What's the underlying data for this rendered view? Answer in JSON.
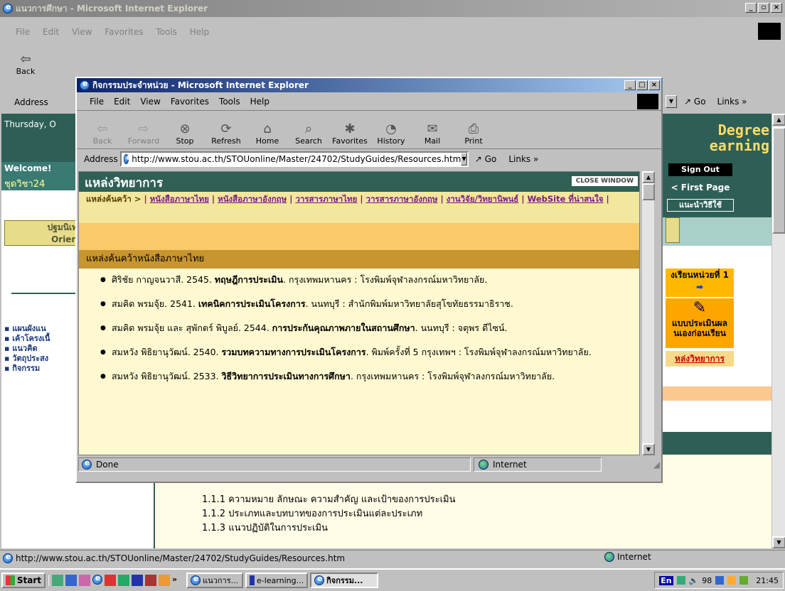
{
  "bg_window": {
    "title": "แนวการศึกษา - Microsoft Internet Explorer",
    "menu": [
      "File",
      "Edit",
      "View",
      "Favorites",
      "Tools",
      "Help"
    ],
    "toolbar": [
      "Back"
    ],
    "address_label": "Address",
    "go_label": "Go",
    "links_label": "Links »",
    "date_text": "Thursday, O",
    "welcome": "Welcome!",
    "course": "ชุดวิชา24",
    "orient_1": "ปฐมนิเท",
    "orient_2": "Orien",
    "left_menu": [
      "แผนผังแน",
      "เค้าโครงเนื้",
      "แนวคิด",
      "วัตถุประสง",
      "กิจกรรม"
    ],
    "degree_1": "Degree",
    "degree_2": "earning",
    "sign_out": "Sign Out",
    "first_page": "< First Page",
    "guide": "แนะนำวิธีใช้",
    "unit_title": "งเรียนหน่วยที่ 1",
    "eval_1": "แบบประเมินผล",
    "eval_2": "นเองก่อนเรียน",
    "resources_link": "หล่งวิทยาการ",
    "outline": [
      "1.1.1 ความหมาย ลักษณะ ความสำคัญ และเป้าของการประเมิน",
      "1.1.2 ประเภทและบทบาทของการประเมินแต่ละประเภท",
      "1.1.3 แนวปฏิบัติในการประเมิน"
    ],
    "status_url": "http://www.stou.ac.th/STOUonline/Master/24702/StudyGuides/Resources.htm",
    "status_zone": "Internet"
  },
  "popup": {
    "title": "กิจกรรมประจำหน่วย - Microsoft Internet Explorer",
    "menu": [
      "File",
      "Edit",
      "View",
      "Favorites",
      "Tools",
      "Help"
    ],
    "toolbar": [
      "Back",
      "Forward",
      "Stop",
      "Refresh",
      "Home",
      "Search",
      "Favorites",
      "History",
      "Mail",
      "Print"
    ],
    "address_label": "Address",
    "address_value": "http://www.stou.ac.th/STOUonline/Master/24702/StudyGuides/Resources.htm",
    "go_label": "Go",
    "links_label": "Links »",
    "page_title": "แหล่งวิทยาการ",
    "close_window": "CLOSE WINDOW",
    "nav_prefix": "แหล่งค้นคว้า >",
    "nav_links": [
      "หนังสือภาษาไทย",
      "หนังสือภาษาอังกฤษ",
      "วารสารภาษาไทย",
      "วารสารภาษาอังกฤษ",
      "งานวิจัย/วิทยานิพนธ์",
      "WebSite ที่น่าสนใจ"
    ],
    "section_header": "แหล่งค้นคว้าหนังสือภาษาไทย",
    "references": [
      {
        "pre": "ศิริชัย กาญจนวาสี. 2545. ",
        "title": "ทฤษฎีการประเมิน",
        "post": ". กรุงเทพมหานคร : โรงพิมพ์จุฬาลงกรณ์มหาวิทยาลัย."
      },
      {
        "pre": "สมคิด พรมจุ้ย. 2541. ",
        "title": "เทคนิคการประเมินโครงการ",
        "post": ". นนทบุรี : สำนักพิมพ์มหาวิทยาลัยสุโขทัยธรรมาธิราช."
      },
      {
        "pre": "สมคิด พรมจุ้ย และ สุพักตร์ พิบูลย์. 2544. ",
        "title": "การประกันคุณภาพภายในสถานศึกษา",
        "post": ". นนทบุรี : จตุพร ดีไซน์."
      },
      {
        "pre": "สมหวัง พิธิยานุวัฒน์. 2540. ",
        "title": "รวมบทความทางการประเมินโครงการ",
        "post": ". พิมพ์ครั้งที่ 5 กรุงเทพฯ : โรงพิมพ์จุฬาลงกรณ์มหาวิทยาลัย."
      },
      {
        "pre": "สมหวัง พิธิยานุวัฒน์. 2533. ",
        "title": "วิธีวิทยาการประเมินทางการศึกษา",
        "post": ". กรุงเทพมหานคร : โรงพิมพ์จุฬาลงกรณ์มหาวิทยาลัย."
      }
    ],
    "status_text": "Done",
    "status_zone": "Internet"
  },
  "taskbar": {
    "start": "Start",
    "tasks": [
      "แนวการ...",
      "e-learning...",
      "กิจกรรม..."
    ],
    "tray_text": "En",
    "tray_num": "98",
    "clock": "21:45"
  },
  "colors": {
    "popup_header": "#2f5f55",
    "nav_bg": "#f2e79c",
    "band_orange": "#f9c96a",
    "section_bg": "#c8952f",
    "content_bg": "#fff8d0",
    "link": "#7b1a86"
  }
}
